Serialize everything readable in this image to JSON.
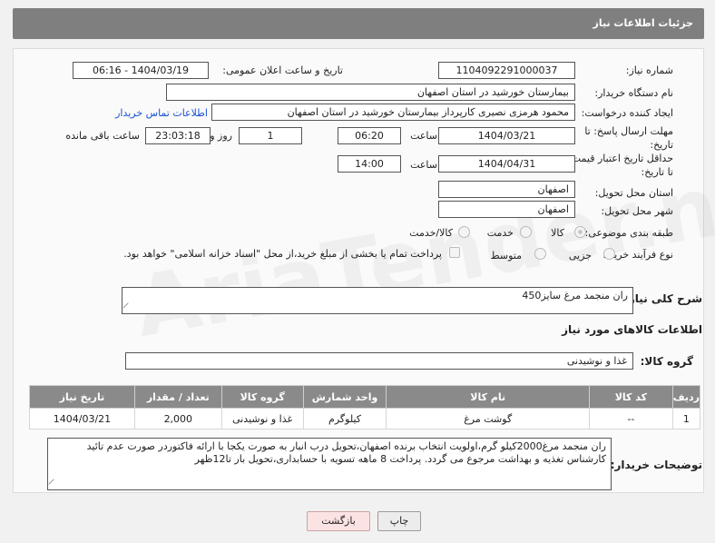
{
  "header": {
    "title": "جزئیات اطلاعات نیاز"
  },
  "fields": {
    "need_number_label": "شماره نیاز:",
    "need_number": "1104092291000037",
    "announce_label": "تاریخ و ساعت اعلان عمومی:",
    "announce_value": "1404/03/19 - 06:16",
    "buyer_org_label": "نام دستگاه خریدار:",
    "buyer_org": "بیمارستان خورشید در استان اصفهان",
    "creator_label": "ایجاد کننده درخواست:",
    "creator": "محمود هرمزی نصیری کارپرداز بیمارستان خورشید در استان اصفهان",
    "contact_link": "اطلاعات تماس خریدار",
    "reply_deadline_label_1": "مهلت ارسال پاسخ: تا",
    "reply_deadline_label_2": "تاریخ:",
    "reply_date": "1404/03/21",
    "time_label": "ساعت",
    "reply_time": "06:20",
    "days_value": "1",
    "days_label": "روز و",
    "remaining_time": "23:03:18",
    "remaining_label": "ساعت باقی مانده",
    "price_validity_label_1": "حداقل تاریخ اعتبار قیمت:",
    "price_validity_label_2": "تا تاریخ:",
    "price_date": "1404/04/31",
    "price_time": "14:00",
    "province_label": "استان محل تحویل:",
    "province": "اصفهان",
    "city_label": "شهر محل تحویل:",
    "city": "اصفهان",
    "category_label": "طبقه بندی موضوعی:",
    "category_options": [
      "کالا",
      "خدمت",
      "کالا/خدمت"
    ],
    "process_label": "نوع فرآیند خرید :",
    "process_options": [
      "جزیی",
      "متوسط"
    ],
    "payment_note": "پرداخت تمام یا بخشی از مبلغ خرید،از محل \"اسناد خزانه اسلامی\" خواهد بود."
  },
  "description": {
    "label": "شرح کلی نیاز:",
    "value": "ران منجمد مرغ سایز450"
  },
  "goods": {
    "section_title": "اطلاعات کالاهای مورد نیاز",
    "group_label": "گروه کالا:",
    "group_value": "غذا و نوشیدنی",
    "columns": [
      "ردیف",
      "کد کالا",
      "نام کالا",
      "واحد شمارش",
      "گروه کالا",
      "تعداد / مقدار",
      "تاریخ نیاز"
    ],
    "rows": [
      [
        "1",
        "--",
        "گوشت مرغ",
        "کیلوگرم",
        "غذا و نوشیدنی",
        "2,000",
        "1404/03/21"
      ]
    ]
  },
  "buyer_notes": {
    "label": "توضیحات خریدار:",
    "value": "ران منجمد مرغ2000کیلو گرم،اولویت انتخاب برنده اصفهان،تحویل درب انبار به صورت یکجا با  ارائه فاکتوردر صورت عدم تائید کارشناس تغذیه و بهداشت مرجوع می گردد. پرداخت 8 ماهه تسویه با حسابداری،تحویل بار تا12ظهر"
  },
  "buttons": {
    "print": "چاپ",
    "back": "بازگشت"
  }
}
